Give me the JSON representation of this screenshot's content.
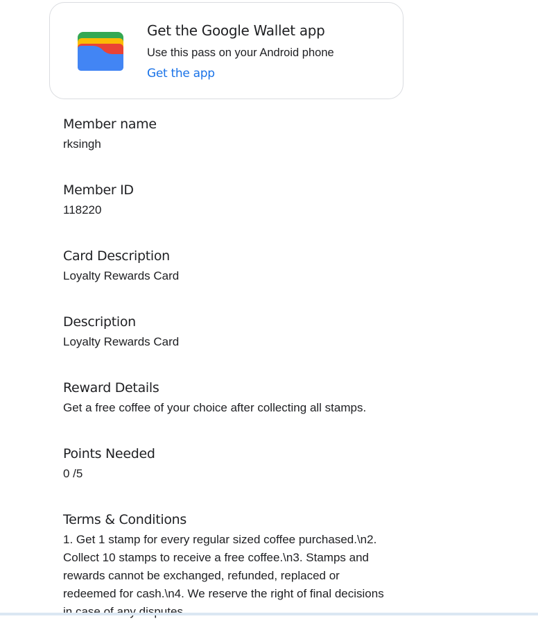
{
  "promo": {
    "title": "Get the Google Wallet app",
    "subtitle": "Use this pass on your Android phone",
    "link_label": "Get the app",
    "icon": "google-wallet-icon",
    "icon_colors": [
      "#34a853",
      "#fbbc04",
      "#ea4335",
      "#4285f4"
    ]
  },
  "fields": {
    "member_name": {
      "label": "Member name",
      "value": "rksingh"
    },
    "member_id": {
      "label": "Member ID",
      "value": "118220"
    },
    "card_description": {
      "label": "Card Description",
      "value": "Loyalty Rewards Card"
    },
    "description": {
      "label": "Description",
      "value": "Loyalty Rewards Card"
    },
    "reward_details": {
      "label": "Reward Details",
      "value": "Get a free coffee of your choice after collecting all stamps."
    },
    "points_needed": {
      "label": "Points Needed",
      "value": "0 /5"
    },
    "terms": {
      "label": "Terms & Conditions",
      "value": "1. Get 1 stamp for every regular sized coffee purchased.\\n2. Collect 10 stamps to receive a free coffee.\\n3. Stamps and rewards cannot be exchanged, refunded, replaced or redeemed for cash.\\n4. We reserve the right of final decisions in case of any disputes."
    }
  },
  "colors": {
    "link": "#1a73e8",
    "text": "#202124",
    "card_border": "#dadce0"
  }
}
